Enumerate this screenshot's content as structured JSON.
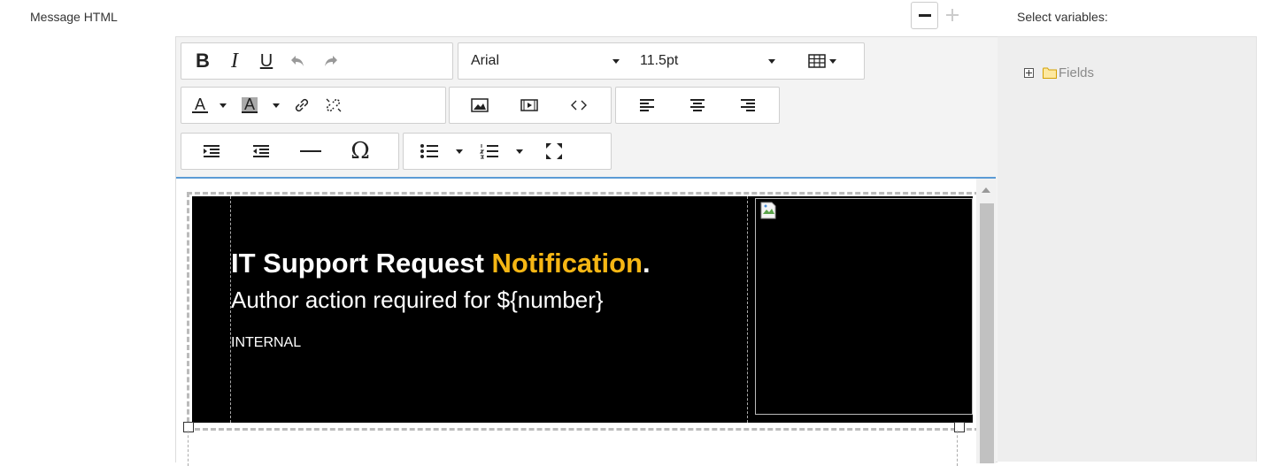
{
  "form": {
    "field_label": "Message HTML",
    "variables_label": "Select variables:"
  },
  "toolbar": {
    "font_family": "Arial",
    "font_size": "11.5pt"
  },
  "variables_tree": {
    "root_label": "Fields"
  },
  "content": {
    "headline_main": "IT Support Request ",
    "headline_accent": "Notification",
    "headline_period": ".",
    "subline": "Author action required for ${number}",
    "classification": "INTERNAL",
    "accent_color": "#f5b614",
    "background_color": "#000000"
  }
}
